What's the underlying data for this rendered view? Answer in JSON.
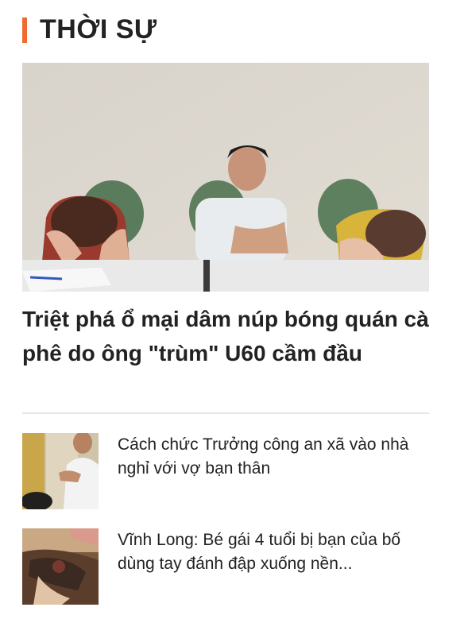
{
  "section": {
    "title": "THỜI SỰ",
    "accent_color": "#f26a2e"
  },
  "featured": {
    "title": "Triệt phá ổ mại dâm núp bóng quán cà phê do ông \"trùm\" U60 cầm đầu",
    "image_icon": "photo-three-people-at-table"
  },
  "news": [
    {
      "title": "Cách chức Trưởng công an xã vào nhà nghỉ với vợ bạn thân",
      "image_icon": "photo-man-in-room"
    },
    {
      "title": "Vĩnh Long: Bé gái 4 tuổi bị bạn của bố dùng tay đánh đập xuống nền...",
      "image_icon": "photo-injured-child"
    }
  ]
}
